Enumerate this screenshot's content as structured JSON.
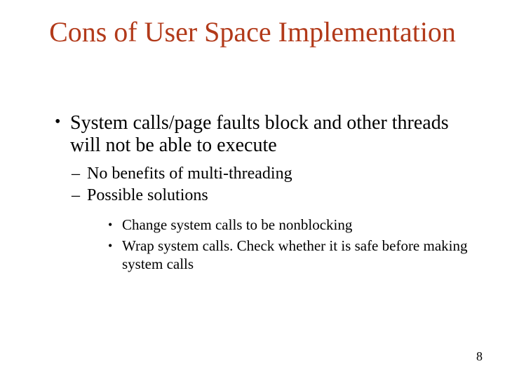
{
  "slide": {
    "title": "Cons of User Space Implementation",
    "bullets": [
      {
        "text": "System calls/page faults block and other threads will not be able to execute",
        "sub": [
          {
            "text": "No benefits of multi-threading"
          },
          {
            "text": "Possible solutions",
            "sub": [
              {
                "text": "Change system calls to be nonblocking"
              },
              {
                "text": "Wrap system calls. Check whether it is safe before making system calls"
              }
            ]
          }
        ]
      }
    ],
    "page_number": "8"
  }
}
